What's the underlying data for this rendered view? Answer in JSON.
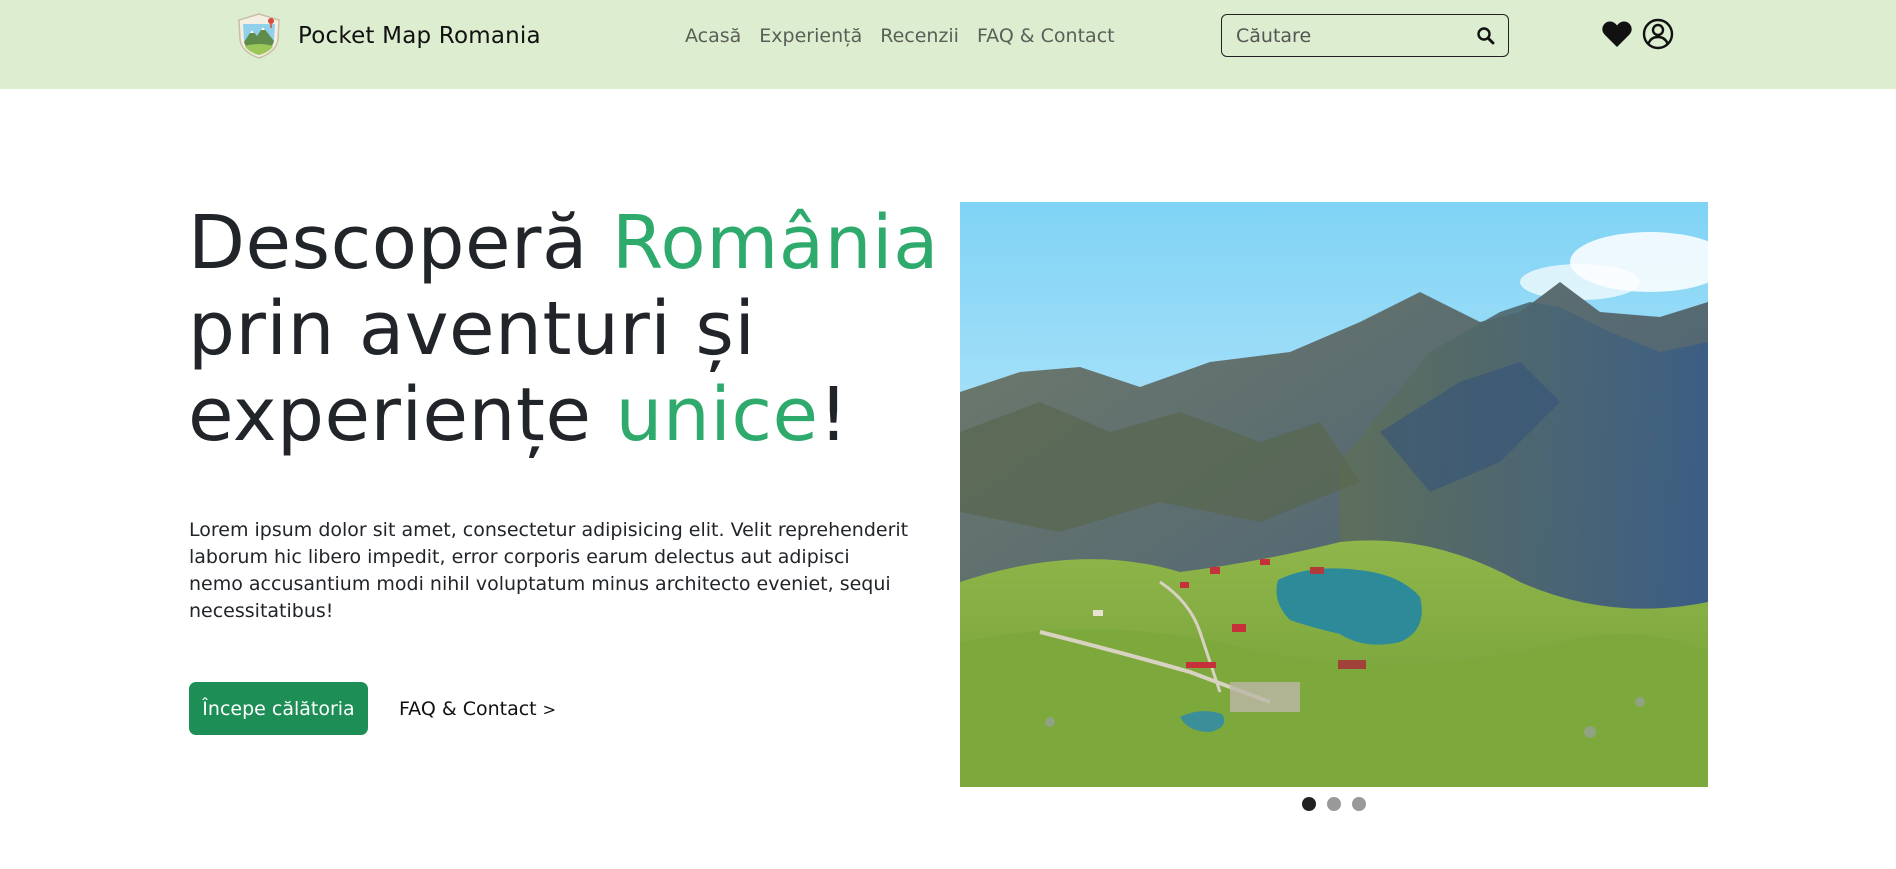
{
  "navbar": {
    "brand_name": "Pocket Map Romania",
    "links": [
      {
        "label": "Acasă"
      },
      {
        "label": "Experiență"
      },
      {
        "label": "Recenzii"
      },
      {
        "label": "FAQ & Contact"
      }
    ],
    "search_placeholder": "Căutare",
    "icons": [
      "search-icon",
      "heart-icon",
      "user-icon"
    ]
  },
  "hero": {
    "title_part1": "Descoperă ",
    "title_accent1": "România",
    "title_part2": "prin aventuri și",
    "title_part3": "experiențe ",
    "title_accent2": "unice",
    "title_end": "!",
    "text": "Lorem ipsum dolor sit amet, consectetur adipisicing elit. Velit reprehenderit laborum hic libero impedit, error corporis earum delectus aut adipisci nemo accusantium modi nihil voluptatum minus architecto eveniet, sequi necessitatibus!",
    "primary_button": "Începe călătoria",
    "secondary_link": "FAQ & Contact",
    "secondary_chevron": ">"
  },
  "carousel": {
    "slide_count": 3,
    "active_slide": 1
  },
  "colors": {
    "navbar_bg": "#dcedd0",
    "accent": "#2eaa6d",
    "primary_button": "#1d8f56",
    "text": "#212529"
  }
}
